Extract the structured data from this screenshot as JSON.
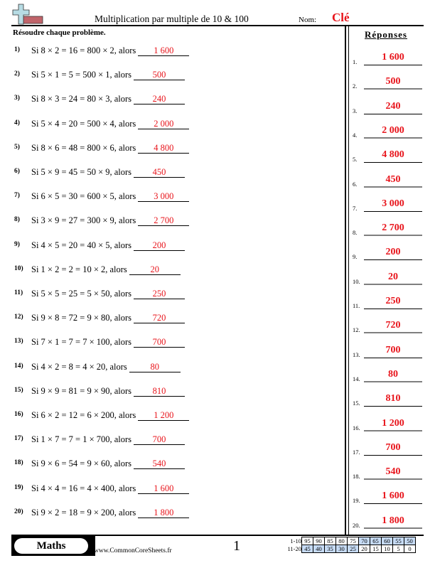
{
  "header": {
    "title": "Multiplication par multiple de 10 & 100",
    "name_label": "Nom:",
    "name_value": "Clé",
    "instructions": "Résoudre chaque problème.",
    "logo_icon": "plus-and-minus-logo-icon"
  },
  "problems": [
    {
      "number": "1)",
      "text": "Si 8 × 2 = 16 = 800 × 2, alors",
      "answer": "1 600"
    },
    {
      "number": "2)",
      "text": "Si 5 × 1 = 5 = 500 × 1, alors",
      "answer": "500"
    },
    {
      "number": "3)",
      "text": "Si 8 × 3 = 24 = 80 × 3, alors",
      "answer": "240"
    },
    {
      "number": "4)",
      "text": "Si 5 × 4 = 20 = 500 × 4, alors",
      "answer": "2 000"
    },
    {
      "number": "5)",
      "text": "Si 8 × 6 = 48 = 800 × 6, alors",
      "answer": "4 800"
    },
    {
      "number": "6)",
      "text": "Si 5 × 9 = 45 = 50 × 9, alors",
      "answer": "450"
    },
    {
      "number": "7)",
      "text": "Si 6 × 5 = 30 = 600 × 5, alors",
      "answer": "3 000"
    },
    {
      "number": "8)",
      "text": "Si 3 × 9 = 27 = 300 × 9, alors",
      "answer": "2 700"
    },
    {
      "number": "9)",
      "text": "Si 4 × 5 = 20 = 40 × 5, alors",
      "answer": "200"
    },
    {
      "number": "10)",
      "text": "Si 1 × 2 = 2 = 10 × 2, alors",
      "answer": "20"
    },
    {
      "number": "11)",
      "text": "Si 5 × 5 = 25 = 5 × 50, alors",
      "answer": "250"
    },
    {
      "number": "12)",
      "text": "Si 9 × 8 = 72 = 9 × 80, alors",
      "answer": "720"
    },
    {
      "number": "13)",
      "text": "Si 7 × 1 = 7 = 7 × 100, alors",
      "answer": "700"
    },
    {
      "number": "14)",
      "text": "Si 4 × 2 = 8 = 4 × 20, alors",
      "answer": "80"
    },
    {
      "number": "15)",
      "text": "Si 9 × 9 = 81 = 9 × 90, alors",
      "answer": "810"
    },
    {
      "number": "16)",
      "text": "Si 6 × 2 = 12 = 6 × 200, alors",
      "answer": "1 200"
    },
    {
      "number": "17)",
      "text": "Si 1 × 7 = 7 = 1 × 700, alors",
      "answer": "700"
    },
    {
      "number": "18)",
      "text": "Si 9 × 6 = 54 = 9 × 60, alors",
      "answer": "540"
    },
    {
      "number": "19)",
      "text": "Si 4 × 4 = 16 = 4 × 400, alors",
      "answer": "1 600"
    },
    {
      "number": "20)",
      "text": "Si 9 × 2 = 18 = 9 × 200, alors",
      "answer": "1 800"
    }
  ],
  "answer_key": {
    "title": "Réponses",
    "items": [
      {
        "label": "1.",
        "value": "1 600"
      },
      {
        "label": "2.",
        "value": "500"
      },
      {
        "label": "3.",
        "value": "240"
      },
      {
        "label": "4.",
        "value": "2 000"
      },
      {
        "label": "5.",
        "value": "4 800"
      },
      {
        "label": "6.",
        "value": "450"
      },
      {
        "label": "7.",
        "value": "3 000"
      },
      {
        "label": "8.",
        "value": "2 700"
      },
      {
        "label": "9.",
        "value": "200"
      },
      {
        "label": "10.",
        "value": "20"
      },
      {
        "label": "11.",
        "value": "250"
      },
      {
        "label": "12.",
        "value": "720"
      },
      {
        "label": "13.",
        "value": "700"
      },
      {
        "label": "14.",
        "value": "80"
      },
      {
        "label": "15.",
        "value": "810"
      },
      {
        "label": "16.",
        "value": "1 200"
      },
      {
        "label": "17.",
        "value": "700"
      },
      {
        "label": "18.",
        "value": "540"
      },
      {
        "label": "19.",
        "value": "1 600"
      },
      {
        "label": "20.",
        "value": "1 800"
      }
    ]
  },
  "footer": {
    "subject": "Maths",
    "website": "www.CommonCoreSheets.fr",
    "page_number": "1",
    "score_table": {
      "row_labels": [
        "1-10",
        "11-20"
      ],
      "rows": [
        [
          "95",
          "90",
          "85",
          "80",
          "75",
          "70",
          "65",
          "60",
          "55",
          "50"
        ],
        [
          "45",
          "40",
          "35",
          "30",
          "25",
          "20",
          "15",
          "10",
          "5",
          "0"
        ]
      ]
    }
  },
  "colors": {
    "answer_red": "#e8141b",
    "score_highlight": "#c6dbf5",
    "logo_plus": "#b7dce4",
    "logo_minus": "#c0646a"
  }
}
